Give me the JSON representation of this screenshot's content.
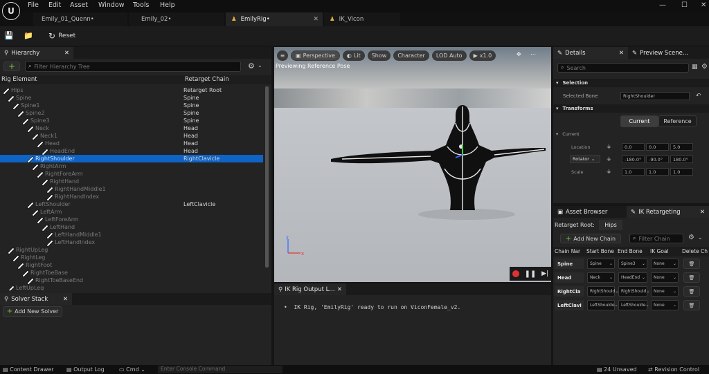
{
  "app": {
    "logo": "U"
  },
  "menu": [
    "File",
    "Edit",
    "Asset",
    "Window",
    "Tools",
    "Help"
  ],
  "doc_tabs": [
    {
      "label": "Emily_01_Quenn•"
    },
    {
      "label": "Emily_02•"
    },
    {
      "label": "EmilyRig•"
    },
    {
      "label": "IK_Vicon"
    }
  ],
  "toolbar": {
    "reset_label": "Reset"
  },
  "hierarchy": {
    "tab_label": "Hierarchy",
    "search_placeholder": "Filter Hierarchy Tree",
    "col_element": "Rig Element",
    "col_chain": "Retarget Chain",
    "rows": [
      {
        "name": "Hips",
        "chain": "Retarget Root",
        "indent": 0
      },
      {
        "name": "Spine",
        "chain": "Spine",
        "indent": 1
      },
      {
        "name": "Spine1",
        "chain": "Spine",
        "indent": 2
      },
      {
        "name": "Spine2",
        "chain": "Spine",
        "indent": 3
      },
      {
        "name": "Spine3",
        "chain": "Spine",
        "indent": 4
      },
      {
        "name": "Neck",
        "chain": "Head",
        "indent": 5
      },
      {
        "name": "Neck1",
        "chain": "Head",
        "indent": 6
      },
      {
        "name": "Head",
        "chain": "Head",
        "indent": 7
      },
      {
        "name": "HeadEnd",
        "chain": "Head",
        "indent": 8
      },
      {
        "name": "RightShoulder",
        "chain": "RightClavicle",
        "indent": 5,
        "selected": true
      },
      {
        "name": "RightArm",
        "chain": "",
        "indent": 6
      },
      {
        "name": "RightForeArm",
        "chain": "",
        "indent": 7
      },
      {
        "name": "RightHand",
        "chain": "",
        "indent": 8
      },
      {
        "name": "RightHandMiddle1",
        "chain": "",
        "indent": 9
      },
      {
        "name": "RightHandIndex",
        "chain": "",
        "indent": 9
      },
      {
        "name": "LeftShoulder",
        "chain": "LeftClavicle",
        "indent": 5
      },
      {
        "name": "LeftArm",
        "chain": "",
        "indent": 6
      },
      {
        "name": "LeftForeArm",
        "chain": "",
        "indent": 7
      },
      {
        "name": "LeftHand",
        "chain": "",
        "indent": 8
      },
      {
        "name": "LeftHandMiddle1",
        "chain": "",
        "indent": 9
      },
      {
        "name": "LeftHandIndex",
        "chain": "",
        "indent": 9
      },
      {
        "name": "RightUpLeg",
        "chain": "",
        "indent": 1
      },
      {
        "name": "RightLeg",
        "chain": "",
        "indent": 2
      },
      {
        "name": "RightFoot",
        "chain": "",
        "indent": 3
      },
      {
        "name": "RightToeBase",
        "chain": "",
        "indent": 4
      },
      {
        "name": "RightToeBaseEnd",
        "chain": "",
        "indent": 5
      },
      {
        "name": "LeftUpLeg",
        "chain": "",
        "indent": 1
      }
    ]
  },
  "solver": {
    "tab_label": "Solver Stack",
    "add_label": "Add New Solver"
  },
  "viewport": {
    "perspective": "Perspective",
    "lit": "Lit",
    "show": "Show",
    "character": "Character",
    "lod": "LOD Auto",
    "speed": "x1.0",
    "preview_text": "Previewing Reference Pose"
  },
  "output_log": {
    "tab_label": "IK Rig Output L...",
    "message": "IK Rig, 'EmilyRig' ready to run on ViconFemale_v2."
  },
  "details": {
    "tab_label": "Details",
    "preview_tab_label": "Preview Scene...",
    "search_placeholder": "Search",
    "selection_header": "Selection",
    "selected_bone_label": "Selected Bone",
    "selected_bone_value": "RightShoulder",
    "transforms_header": "Transforms",
    "current_label": "Current",
    "reference_label": "Reference",
    "current_sub": "Current",
    "location_label": "Location",
    "location": [
      "0.0",
      "0.0",
      "5.0"
    ],
    "rotation_label": "Rotator",
    "rotation": [
      "-180.0°",
      "-90.0°",
      "180.0°"
    ],
    "scale_label": "Scale",
    "scale": [
      "1.0",
      "1.0",
      "1.0"
    ]
  },
  "retargeting": {
    "asset_browser_label": "Asset Browser",
    "tab_label": "IK Retargeting",
    "root_label": "Retarget Root:",
    "root_value": "Hips",
    "add_chain_label": "Add New Chain",
    "filter_placeholder": "Filter Chain",
    "headers": [
      "Chain Nar",
      "Start Bone",
      "End Bone",
      "IK Goal",
      "Delete Ch"
    ],
    "chains": [
      {
        "name": "Spine",
        "start": "Spine",
        "end": "Spine3",
        "goal": "None"
      },
      {
        "name": "Head",
        "start": "Neck",
        "end": "HeadEnd",
        "goal": "None"
      },
      {
        "name": "RightCla",
        "start": "RightShould",
        "end": "RightShould",
        "goal": "None"
      },
      {
        "name": "LeftClavi",
        "start": "LeftShoulde",
        "end": "LeftShoulde",
        "goal": "None"
      }
    ]
  },
  "status": {
    "content_drawer": "Content Drawer",
    "output_log": "Output Log",
    "cmd": "Cmd",
    "console_placeholder": "Enter Console Command",
    "unsaved": "24 Unsaved",
    "revision": "Revision Control"
  },
  "colors": {
    "accent": "#0e63c4",
    "green": "#78c046",
    "panel": "#232323"
  }
}
